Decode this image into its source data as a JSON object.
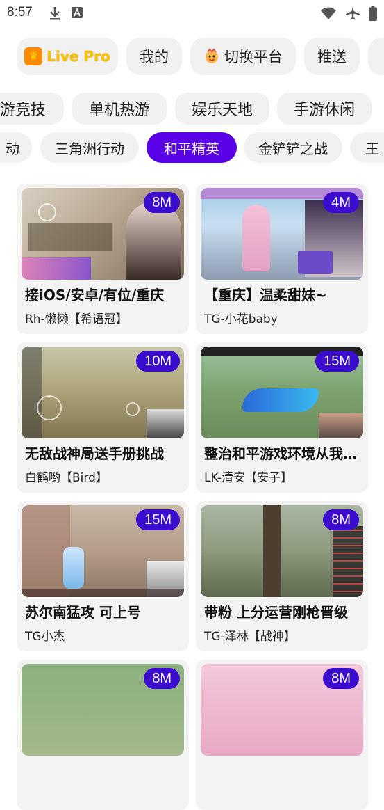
{
  "status": {
    "time": "8:57"
  },
  "categories_row1": [
    {
      "label": "Live Pro"
    },
    {
      "label": "我的"
    },
    {
      "label": "切换平台"
    },
    {
      "label": "推送"
    }
  ],
  "categories_row2": [
    {
      "label": "游竞技"
    },
    {
      "label": "单机热游"
    },
    {
      "label": "娱乐天地"
    },
    {
      "label": "手游休闲"
    }
  ],
  "categories_row3": [
    {
      "label": "动"
    },
    {
      "label": "三角洲行动"
    },
    {
      "label": "和平精英",
      "active": true
    },
    {
      "label": "金铲铲之战"
    },
    {
      "label": "王"
    }
  ],
  "streams": [
    {
      "badge": "8M",
      "title": "接iOS/安卓/有位/重庆",
      "streamer": "Rh-懒懒【希语冠】"
    },
    {
      "badge": "4M",
      "title": "【重庆】温柔甜妹~",
      "streamer": "TG-小花baby"
    },
    {
      "badge": "10M",
      "title": "无敌战神局送手册挑战",
      "streamer": "白鹤哟【Bird】"
    },
    {
      "badge": "15M",
      "title": "整治和平游戏环境从我做起",
      "streamer": "LK-清安【安子】"
    },
    {
      "badge": "15M",
      "title": "苏尔南猛攻 可上号",
      "streamer": "TG小杰"
    },
    {
      "badge": "8M",
      "title": " 带粉 上分运营刚枪晋级",
      "streamer": "TG-泽林【战神】"
    },
    {
      "badge": "8M",
      "title": "",
      "streamer": ""
    },
    {
      "badge": "8M",
      "title": "",
      "streamer": ""
    }
  ],
  "colors": {
    "accent": "#5a00e6",
    "badge": "#3c0ccf",
    "pill_bg": "#f1f1f1"
  }
}
